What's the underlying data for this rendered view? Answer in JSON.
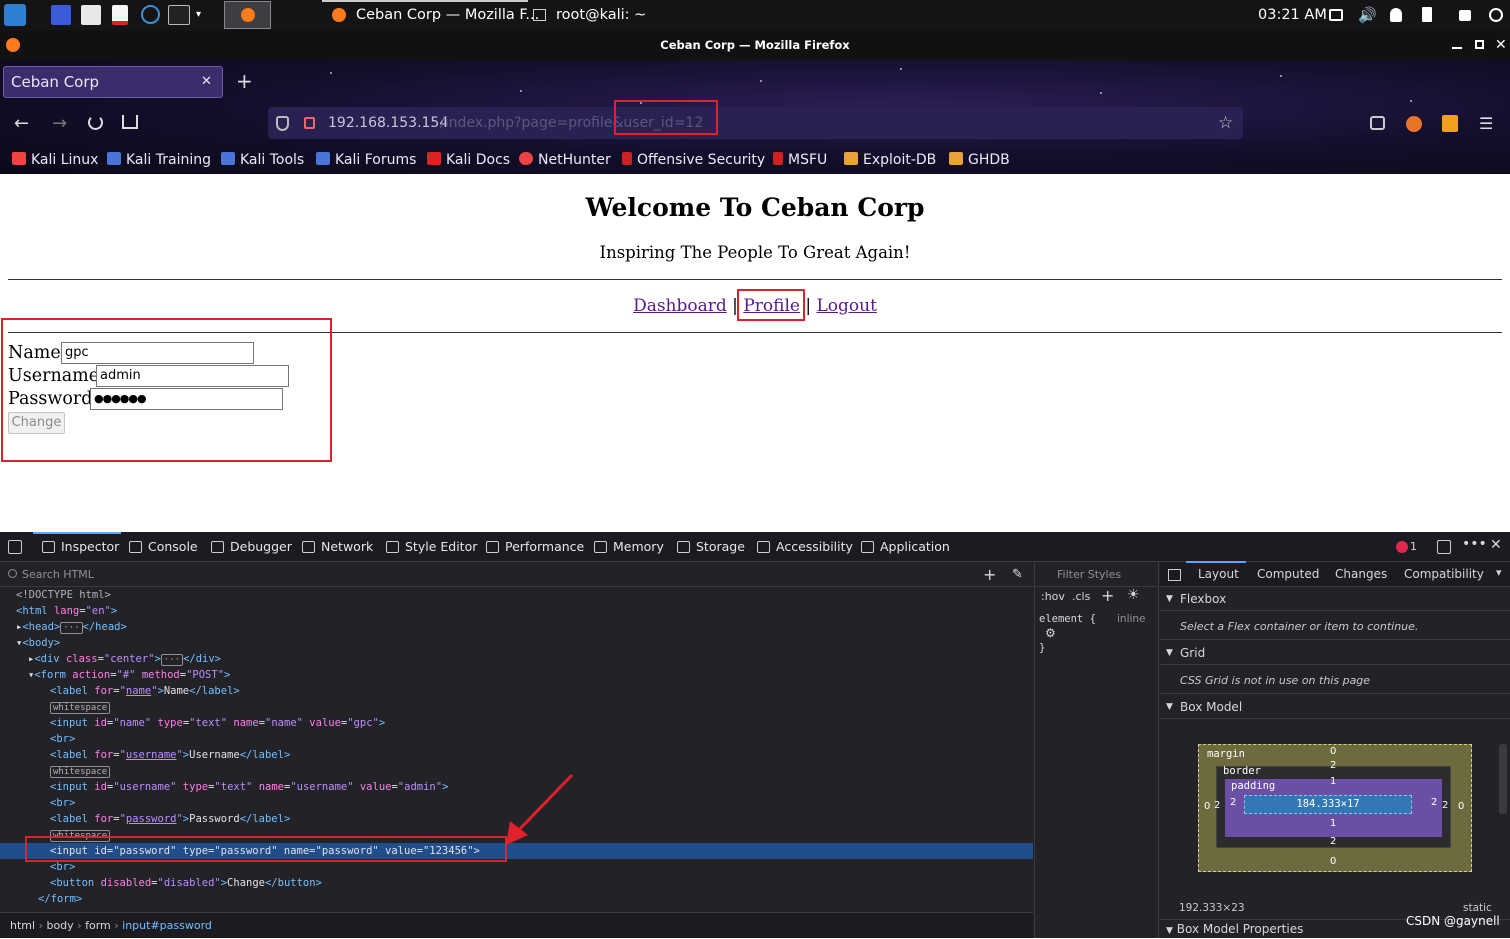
{
  "taskbar": {
    "clock": "03:21 AM",
    "firefox_window": "Ceban Corp — Mozilla F...",
    "terminal_window": "root@kali: ~"
  },
  "window": {
    "title": "Ceban Corp — Mozilla Firefox"
  },
  "browser": {
    "tab_title": "Ceban Corp",
    "url_host": "192.168.153.154",
    "url_path": "/index.php?page=profile&user_id=12"
  },
  "bookmarks": [
    "Kali Linux",
    "Kali Training",
    "Kali Tools",
    "Kali Forums",
    "Kali Docs",
    "NetHunter",
    "Offensive Security",
    "MSFU",
    "Exploit-DB",
    "GHDB"
  ],
  "page": {
    "heading": "Welcome To Ceban Corp",
    "subheading": "Inspiring The People To Great Again!",
    "nav": {
      "dashboard": "Dashboard",
      "profile": "Profile",
      "logout": "Logout",
      "sep": "|"
    },
    "form": {
      "name_label": "Name",
      "name_value": "gpc",
      "username_label": "Username",
      "username_value": "admin",
      "password_label": "Password",
      "password_mask": "●●●●●●",
      "button": "Change"
    }
  },
  "devtools": {
    "tabs": [
      "Inspector",
      "Console",
      "Debugger",
      "Network",
      "Style Editor",
      "Performance",
      "Memory",
      "Storage",
      "Accessibility",
      "Application"
    ],
    "search_placeholder": "Search HTML",
    "error_count": "1",
    "breadcrumb": [
      "html",
      "body",
      "form",
      "input#password"
    ],
    "styles": {
      "filter_placeholder": "Filter Styles",
      "hov": ":hov",
      "cls": ".cls",
      "rule_selector": "element {",
      "rule_close": "}",
      "rule_source": "inline"
    },
    "layout_tabs": [
      "Layout",
      "Computed",
      "Changes",
      "Compatibility"
    ],
    "flexbox": {
      "title": "Flexbox",
      "note": "Select a Flex container or item to continue."
    },
    "grid": {
      "title": "Grid",
      "note": "CSS Grid is not in use on this page"
    },
    "boxmodel": {
      "title": "Box Model",
      "margin_label": "margin",
      "border_label": "border",
      "padding_label": "padding",
      "content": "184.333×17",
      "margin_top": "0",
      "margin_bottom": "0",
      "margin_left": "0",
      "margin_right": "0",
      "border_top": "2",
      "border_bottom": "2",
      "border_left": "2",
      "border_right": "2",
      "padding_top": "1",
      "padding_bottom": "1",
      "padding_left": "2",
      "padding_right": "2",
      "size": "192.333×23",
      "position": "static"
    },
    "boxmodel_props": "Box Model Properties",
    "watermark": "CSDN @gaynell"
  }
}
